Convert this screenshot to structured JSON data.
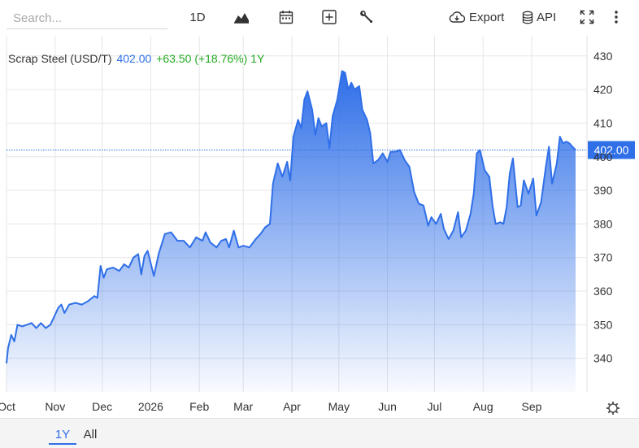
{
  "toolbar": {
    "search_placeholder": "Search...",
    "interval_label": "1D",
    "export_label": "Export",
    "api_label": "API"
  },
  "legend": {
    "symbol": "Scrap Steel (USD/T)",
    "price": "402.00",
    "change": "+63.50",
    "change_pct": "(+18.76%)",
    "period": "1Y"
  },
  "colors": {
    "line": "#2f6fe8",
    "price_text": "#2f6fe8",
    "change_text": "#22aa22",
    "grid": "#e6e6e6",
    "badge": "#2f6fe8"
  },
  "ranges": [
    "1Y",
    "All"
  ],
  "active_range": "1Y",
  "chart_data": {
    "type": "area",
    "title": "Scrap Steel (USD/T)",
    "xlabel": "",
    "ylabel": "",
    "ylim": [
      330,
      436
    ],
    "y_ticks": [
      340,
      350,
      360,
      370,
      380,
      390,
      400,
      410,
      420,
      430
    ],
    "last_value": 402.0,
    "last_value_label": "402.00",
    "grid": true,
    "x_ticks": [
      {
        "label": "Oct",
        "date": "2025-10-01"
      },
      {
        "label": "Nov",
        "date": "2025-11-01"
      },
      {
        "label": "Dec",
        "date": "2025-12-01"
      },
      {
        "label": "2026",
        "date": "2026-01-01"
      },
      {
        "label": "Feb",
        "date": "2026-02-01"
      },
      {
        "label": "Mar",
        "date": "2026-03-01"
      },
      {
        "label": "Apr",
        "date": "2026-04-01"
      },
      {
        "label": "May",
        "date": "2026-05-01"
      },
      {
        "label": "Jun",
        "date": "2026-06-01"
      },
      {
        "label": "Jul",
        "date": "2026-07-01"
      },
      {
        "label": "Aug",
        "date": "2026-08-01"
      },
      {
        "label": "Sep",
        "date": "2026-09-01"
      }
    ],
    "x_range": [
      "2025-10-01",
      "2026-09-29"
    ],
    "series": [
      {
        "name": "",
        "points": [
          [
            "2025-10-01",
            338.5
          ],
          [
            "2025-10-02",
            343
          ],
          [
            "2025-10-04",
            347
          ],
          [
            "2025-10-06",
            345
          ],
          [
            "2025-10-08",
            350
          ],
          [
            "2025-10-11",
            349.5
          ],
          [
            "2025-10-14",
            350
          ],
          [
            "2025-10-17",
            350.5
          ],
          [
            "2025-10-20",
            349
          ],
          [
            "2025-10-23",
            350.5
          ],
          [
            "2025-10-26",
            349
          ],
          [
            "2025-10-29",
            350
          ],
          [
            "2025-11-01",
            353
          ],
          [
            "2025-11-03",
            355
          ],
          [
            "2025-11-05",
            356
          ],
          [
            "2025-11-07",
            353.5
          ],
          [
            "2025-11-10",
            356
          ],
          [
            "2025-11-14",
            356.5
          ],
          [
            "2025-11-18",
            356
          ],
          [
            "2025-11-22",
            357
          ],
          [
            "2025-11-26",
            358.5
          ],
          [
            "2025-11-28",
            358
          ],
          [
            "2025-11-30",
            367.5
          ],
          [
            "2025-12-02",
            364
          ],
          [
            "2025-12-04",
            366.5
          ],
          [
            "2025-12-08",
            367
          ],
          [
            "2025-12-12",
            366
          ],
          [
            "2025-12-15",
            368
          ],
          [
            "2025-12-18",
            367
          ],
          [
            "2025-12-21",
            370
          ],
          [
            "2025-12-24",
            371
          ],
          [
            "2025-12-26",
            365
          ],
          [
            "2025-12-28",
            370.5
          ],
          [
            "2025-12-30",
            372
          ],
          [
            "2026-01-03",
            364.5
          ],
          [
            "2026-01-06",
            371
          ],
          [
            "2026-01-10",
            377
          ],
          [
            "2026-01-14",
            377.5
          ],
          [
            "2026-01-18",
            375
          ],
          [
            "2026-01-22",
            375
          ],
          [
            "2026-01-26",
            373
          ],
          [
            "2026-01-30",
            376
          ],
          [
            "2026-02-03",
            375
          ],
          [
            "2026-02-05",
            377.5
          ],
          [
            "2026-02-08",
            374.5
          ],
          [
            "2026-02-12",
            373
          ],
          [
            "2026-02-15",
            375
          ],
          [
            "2026-02-18",
            375.5
          ],
          [
            "2026-02-20",
            373
          ],
          [
            "2026-02-23",
            378
          ],
          [
            "2026-02-26",
            373
          ],
          [
            "2026-03-01",
            373.5
          ],
          [
            "2026-03-05",
            373
          ],
          [
            "2026-03-09",
            375.5
          ],
          [
            "2026-03-12",
            377
          ],
          [
            "2026-03-15",
            379
          ],
          [
            "2026-03-18",
            380
          ],
          [
            "2026-03-20",
            392
          ],
          [
            "2026-03-23",
            398
          ],
          [
            "2026-03-26",
            394
          ],
          [
            "2026-03-29",
            398.5
          ],
          [
            "2026-03-31",
            393
          ],
          [
            "2026-04-02",
            406
          ],
          [
            "2026-04-05",
            411
          ],
          [
            "2026-04-07",
            408.5
          ],
          [
            "2026-04-09",
            417
          ],
          [
            "2026-04-11",
            419.5
          ],
          [
            "2026-04-14",
            414
          ],
          [
            "2026-04-16",
            406.5
          ],
          [
            "2026-04-18",
            411.5
          ],
          [
            "2026-04-20",
            409
          ],
          [
            "2026-04-23",
            410
          ],
          [
            "2026-04-25",
            402.5
          ],
          [
            "2026-04-27",
            412
          ],
          [
            "2026-04-30",
            417
          ],
          [
            "2026-05-03",
            425.5
          ],
          [
            "2026-05-05",
            425
          ],
          [
            "2026-05-07",
            420
          ],
          [
            "2026-05-09",
            422
          ],
          [
            "2026-05-11",
            420
          ],
          [
            "2026-05-14",
            421
          ],
          [
            "2026-05-16",
            414
          ],
          [
            "2026-05-19",
            411
          ],
          [
            "2026-05-21",
            407
          ],
          [
            "2026-05-23",
            398
          ],
          [
            "2026-05-26",
            399
          ],
          [
            "2026-05-29",
            401
          ],
          [
            "2026-06-01",
            398.5
          ],
          [
            "2026-06-03",
            401.5
          ],
          [
            "2026-06-06",
            401.5
          ],
          [
            "2026-06-09",
            402
          ],
          [
            "2026-06-12",
            399
          ],
          [
            "2026-06-15",
            397
          ],
          [
            "2026-06-18",
            389.5
          ],
          [
            "2026-06-21",
            386
          ],
          [
            "2026-06-24",
            385.5
          ],
          [
            "2026-06-27",
            379.5
          ],
          [
            "2026-06-29",
            382
          ],
          [
            "2026-07-02",
            380
          ],
          [
            "2026-07-05",
            383
          ],
          [
            "2026-07-07",
            378.5
          ],
          [
            "2026-07-10",
            375.5
          ],
          [
            "2026-07-13",
            378
          ],
          [
            "2026-07-16",
            383.5
          ],
          [
            "2026-07-18",
            376
          ],
          [
            "2026-07-21",
            378
          ],
          [
            "2026-07-24",
            383
          ],
          [
            "2026-07-26",
            389
          ],
          [
            "2026-07-28",
            401
          ],
          [
            "2026-07-30",
            402
          ],
          [
            "2026-08-02",
            396
          ],
          [
            "2026-08-05",
            394
          ],
          [
            "2026-08-07",
            385.5
          ],
          [
            "2026-08-09",
            380
          ],
          [
            "2026-08-12",
            380.5
          ],
          [
            "2026-08-14",
            380
          ],
          [
            "2026-08-16",
            385
          ],
          [
            "2026-08-18",
            395
          ],
          [
            "2026-08-20",
            399.5
          ],
          [
            "2026-08-23",
            385
          ],
          [
            "2026-08-25",
            385.5
          ],
          [
            "2026-08-27",
            393
          ],
          [
            "2026-08-30",
            389
          ],
          [
            "2026-09-02",
            393.5
          ],
          [
            "2026-09-04",
            382.5
          ],
          [
            "2026-09-07",
            386.5
          ],
          [
            "2026-09-10",
            397
          ],
          [
            "2026-09-12",
            403
          ],
          [
            "2026-09-14",
            392
          ],
          [
            "2026-09-17",
            398
          ],
          [
            "2026-09-19",
            406
          ],
          [
            "2026-09-21",
            404
          ],
          [
            "2026-09-23",
            404.5
          ],
          [
            "2026-09-25",
            404
          ],
          [
            "2026-09-27",
            403
          ],
          [
            "2026-09-29",
            402
          ]
        ]
      }
    ]
  }
}
